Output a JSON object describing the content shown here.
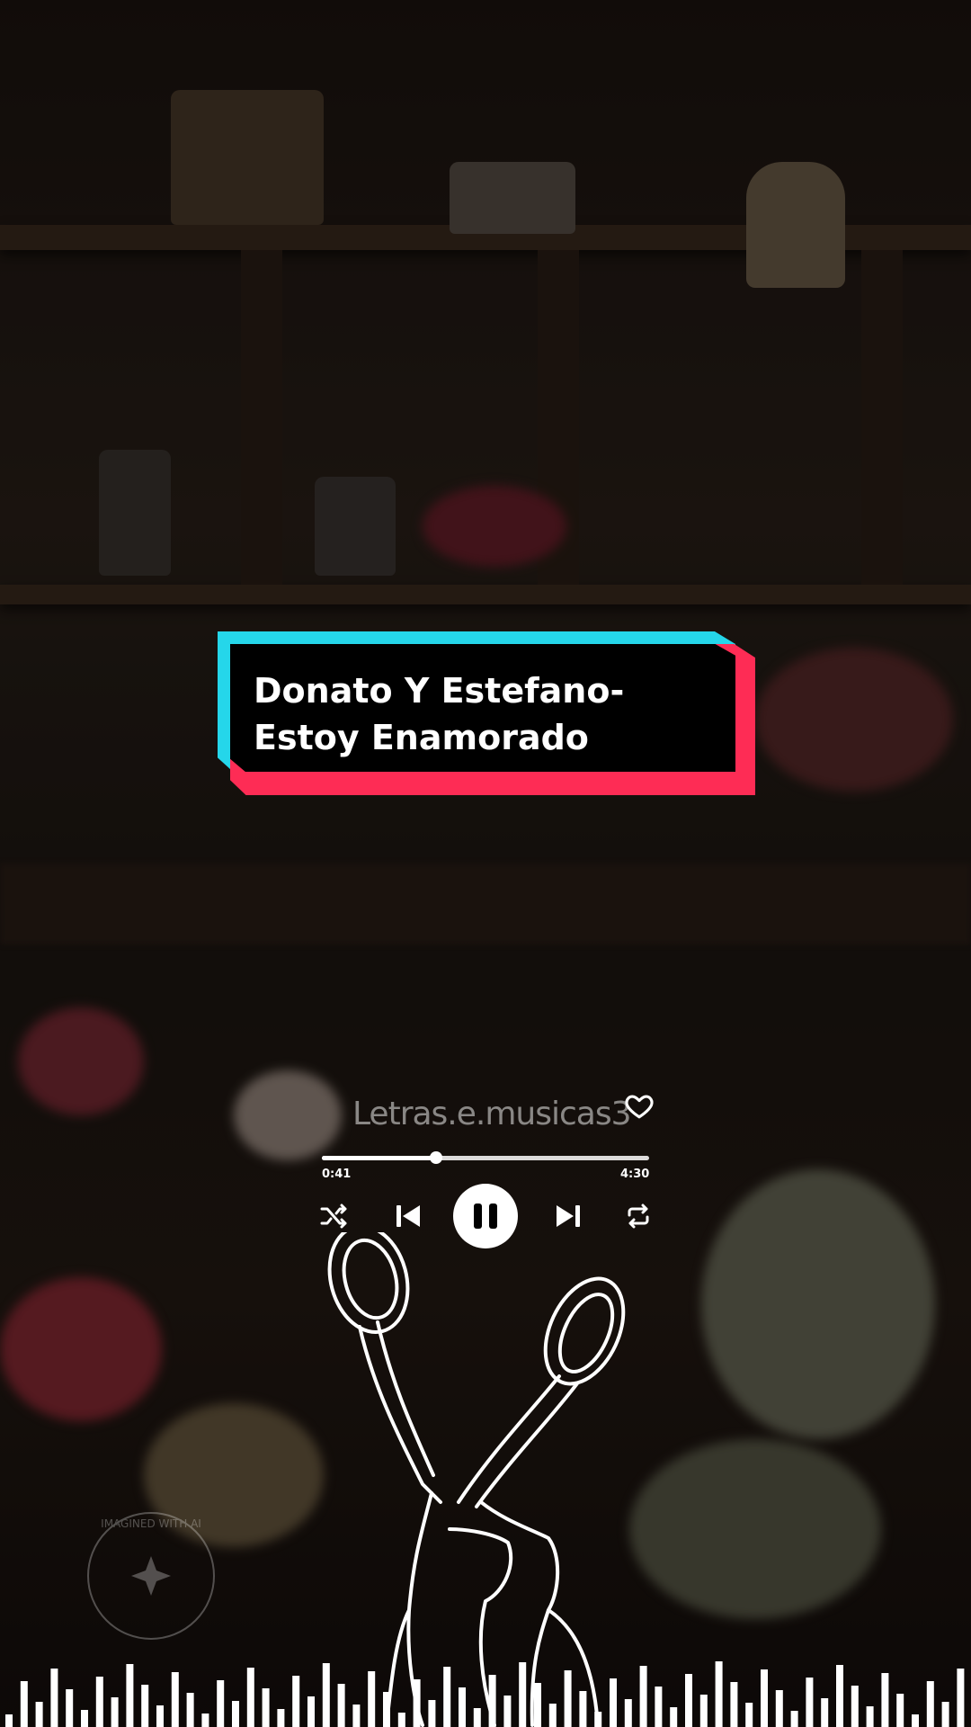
{
  "video": {
    "title_card": "Donato Y Estefano- Estoy Enamorado",
    "colors": {
      "cyan": "#25d6ea",
      "red": "#fe2c55",
      "black": "#000000"
    }
  },
  "player": {
    "account_handle": "Letras.e.musicas3",
    "like_icon": "heart-outline-icon",
    "elapsed": "0:41",
    "duration": "4:30",
    "progress": 0.35,
    "controls": {
      "shuffle": "shuffle-icon",
      "previous": "skip-previous-icon",
      "play_pause": "pause-icon",
      "next": "skip-next-icon",
      "repeat": "repeat-icon"
    }
  },
  "background": {
    "watermark_seal_text": "IMAGINED WITH AI",
    "art": "telephone-handsets-line-art"
  }
}
